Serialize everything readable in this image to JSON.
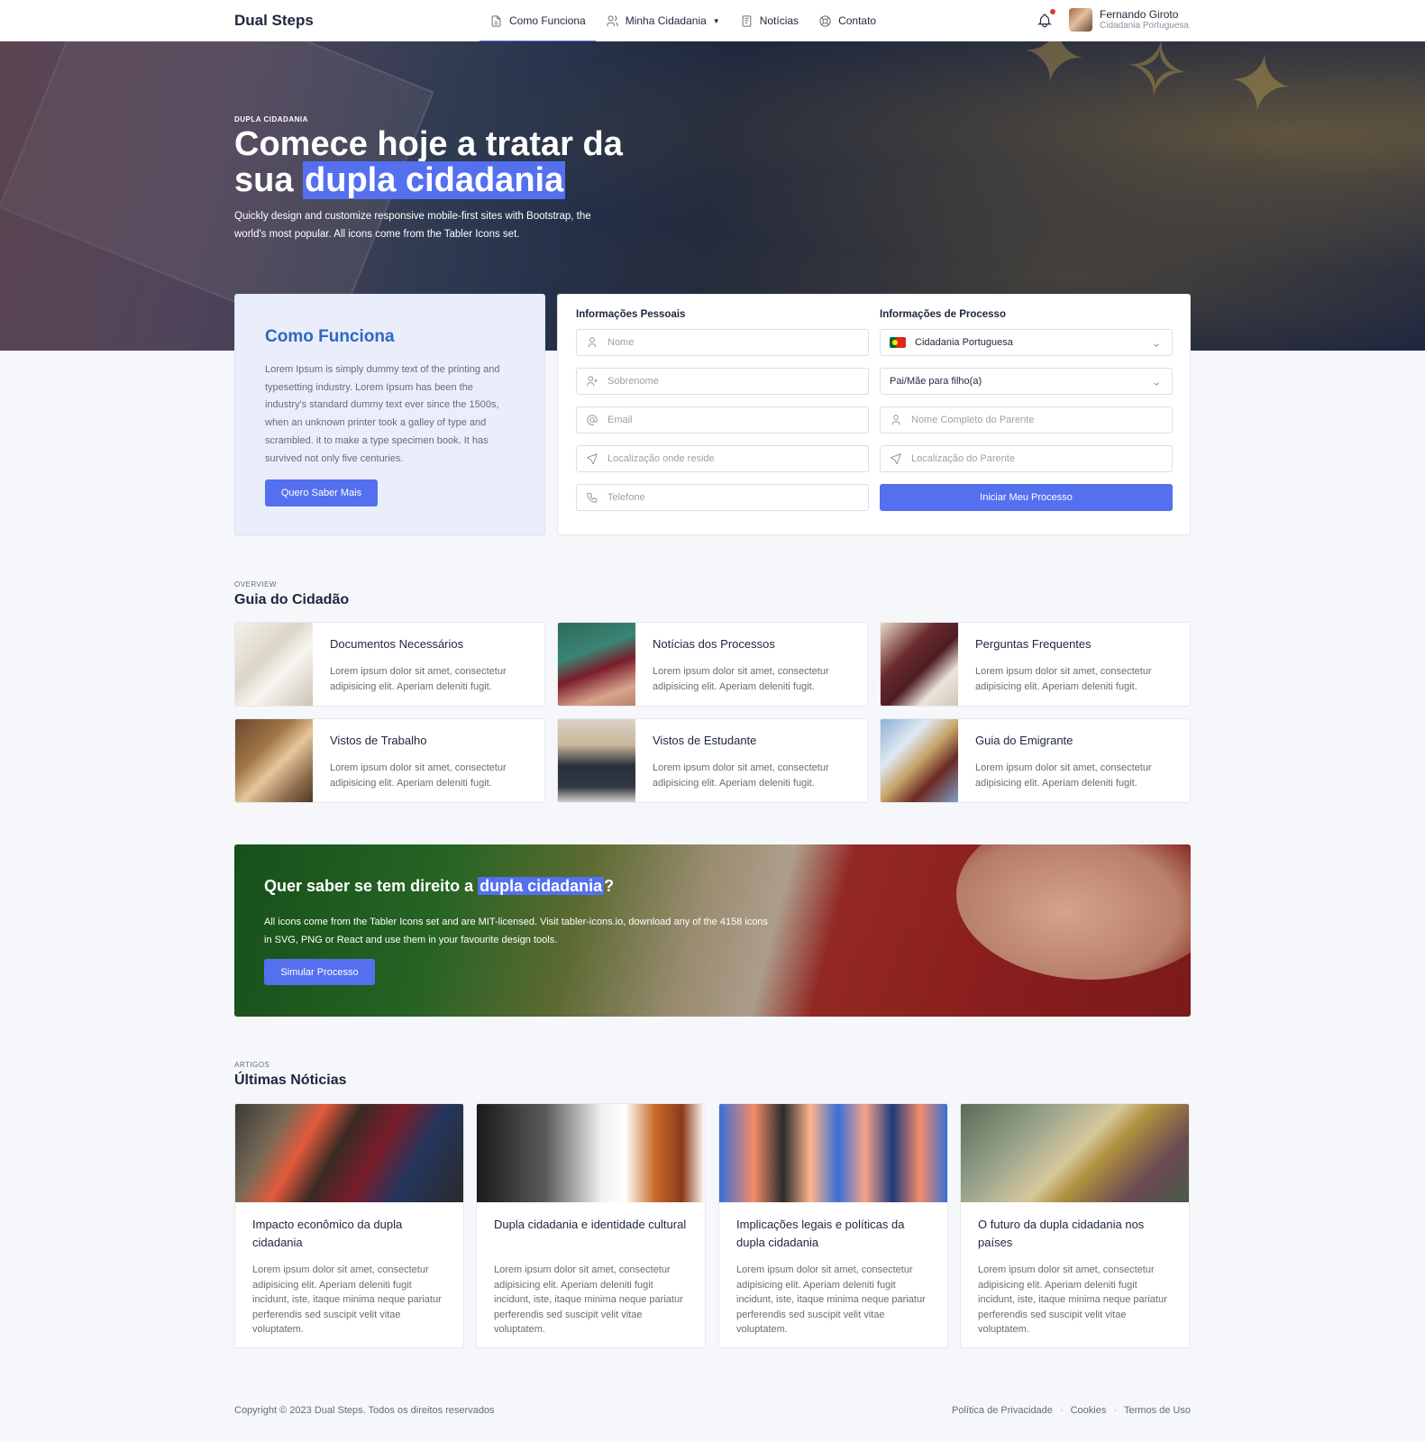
{
  "header": {
    "brand": "Dual Steps",
    "nav": [
      {
        "label": "Como Funciona",
        "icon": "file-text-icon"
      },
      {
        "label": "Minha Cidadania",
        "icon": "users-icon"
      },
      {
        "label": "Notícias",
        "icon": "news-icon"
      },
      {
        "label": "Contato",
        "icon": "lifebuoy-icon"
      }
    ],
    "user": {
      "name": "Fernando Giroto",
      "subtitle": "Cidadania Portuguesa"
    }
  },
  "hero": {
    "kicker": "DUPLA CIDADANIA",
    "title_part1": "Comece hoje a tratar da sua ",
    "title_highlight": "dupla cidadania",
    "text": "Quickly design and customize responsive mobile-first sites with Bootstrap, the world's most popular. All icons come from the Tabler Icons set."
  },
  "how": {
    "title": "Como Funciona",
    "text": "Lorem Ipsum is simply dummy text of the printing and typesetting industry. Lorem Ipsum has been the industry's standard dummy text ever since the 1500s, when an unknown printer took a galley of type and scrambled. it to make a type specimen book. It has survived not only five centuries.",
    "button": "Quero Saber Mais"
  },
  "form": {
    "personal_label": "Informações Pessoais",
    "process_label": "Informações de Processo",
    "personal_fields": [
      {
        "placeholder": "Nome",
        "icon": "user-icon"
      },
      {
        "placeholder": "Sobrenome",
        "icon": "user-plus-icon"
      },
      {
        "placeholder": "Email",
        "icon": "at-icon"
      },
      {
        "placeholder": "Localização onde reside",
        "icon": "send-icon"
      },
      {
        "placeholder": "Telefone",
        "icon": "phone-icon"
      }
    ],
    "citizenship_select": "Cidadania Portuguesa",
    "relation_select": "Pai/Mãe para filho(a)",
    "parent_name_placeholder": "Nome Completo do Parente",
    "parent_location_placeholder": "Localização do Parente",
    "submit": "Iniciar Meu Processo"
  },
  "guide": {
    "kicker": "OVERVIEW",
    "title": "Guia do Cidadão",
    "items": [
      {
        "title": "Documentos Necessários",
        "text": "Lorem ipsum dolor sit amet, consectetur adipisicing elit. Aperiam deleniti fugit."
      },
      {
        "title": "Notícias dos Processos",
        "text": "Lorem ipsum dolor sit amet, consectetur adipisicing elit. Aperiam deleniti fugit."
      },
      {
        "title": "Perguntas Frequentes",
        "text": "Lorem ipsum dolor sit amet, consectetur adipisicing elit. Aperiam deleniti fugit."
      },
      {
        "title": "Vistos de Trabalho",
        "text": "Lorem ipsum dolor sit amet, consectetur adipisicing elit. Aperiam deleniti fugit."
      },
      {
        "title": "Vistos de Estudante",
        "text": "Lorem ipsum dolor sit amet, consectetur adipisicing elit. Aperiam deleniti fugit."
      },
      {
        "title": "Guia do Emigrante",
        "text": "Lorem ipsum dolor sit amet, consectetur adipisicing elit. Aperiam deleniti fugit."
      }
    ]
  },
  "cta": {
    "title_part1": "Quer saber se tem direito a ",
    "title_highlight": "dupla cidadania",
    "title_end": "?",
    "text": "All icons come from the Tabler Icons set and are MIT-licensed. Visit tabler-icons.io, download any of the 4158 icons in SVG, PNG or React and use them in your favourite design tools.",
    "button": "Simular Processo"
  },
  "news": {
    "kicker": "ARTIGOS",
    "title": "Últimas Nóticias",
    "items": [
      {
        "title": "Impacto econômico da dupla cidadania",
        "text": "Lorem ipsum dolor sit amet, consectetur adipisicing elit. Aperiam deleniti fugit incidunt, iste, itaque minima neque pariatur perferendis sed suscipit velit vitae voluptatem."
      },
      {
        "title": "Dupla cidadania e identidade cultural",
        "text": "Lorem ipsum dolor sit amet, consectetur adipisicing elit. Aperiam deleniti fugit incidunt, iste, itaque minima neque pariatur perferendis sed suscipit velit vitae voluptatem."
      },
      {
        "title": "Implicações legais e políticas da dupla cidadania",
        "text": "Lorem ipsum dolor sit amet, consectetur adipisicing elit. Aperiam deleniti fugit incidunt, iste, itaque minima neque pariatur perferendis sed suscipit velit vitae voluptatem."
      },
      {
        "title": "O futuro da dupla cidadania nos países",
        "text": "Lorem ipsum dolor sit amet, consectetur adipisicing elit. Aperiam deleniti fugit incidunt, iste, itaque minima neque pariatur perferendis sed suscipit velit vitae voluptatem."
      }
    ]
  },
  "footer": {
    "copyright": "Copyright © 2023 Dual Steps. Todos os direitos reservados",
    "links": [
      "Política de Privacidade",
      "Cookies",
      "Termos de Uso"
    ]
  },
  "colors": {
    "accent": "#5470ef",
    "how_title": "#2e67c4"
  }
}
